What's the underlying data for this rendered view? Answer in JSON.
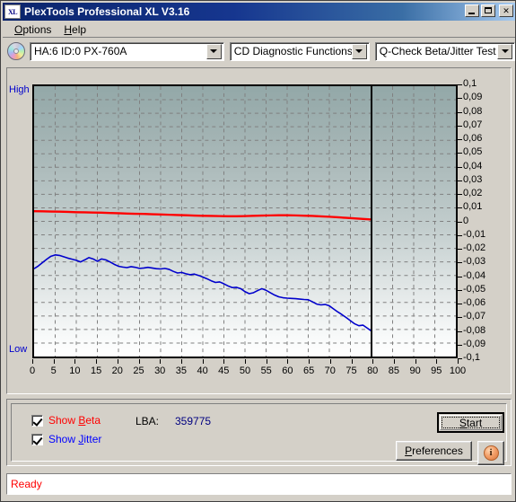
{
  "window": {
    "title": "PlexTools Professional XL V3.16",
    "icon": "XL",
    "controls": {
      "minimize": "minimize-icon",
      "maximize": "maximize-icon",
      "close": "close-icon"
    }
  },
  "menu": {
    "items": [
      {
        "label": "Options",
        "accel": "O"
      },
      {
        "label": "Help",
        "accel": "H"
      }
    ]
  },
  "toolbar": {
    "disc_icon": "cd-disc-icon",
    "drive_select": {
      "value": "HA:6 ID:0  PX-760A",
      "options": [
        "HA:6 ID:0  PX-760A"
      ]
    },
    "function_select": {
      "value": "CD Diagnostic Functions",
      "options": [
        "CD Diagnostic Functions"
      ]
    },
    "test_select": {
      "value": "Q-Check Beta/Jitter Test",
      "options": [
        "Q-Check Beta/Jitter Test"
      ]
    }
  },
  "options_panel": {
    "show_beta": {
      "label": "Show Beta",
      "accel": "B",
      "checked": true,
      "color": "#ff0000"
    },
    "show_jitter": {
      "label": "Show Jitter",
      "accel": "J",
      "checked": true,
      "color": "#0000ff"
    },
    "lba_label": "LBA:",
    "lba_value": "359775",
    "start_button": {
      "label": "Start",
      "accel": "S"
    },
    "preferences_button": {
      "label": "Preferences",
      "accel": "P"
    },
    "info_button": {
      "icon": "info-icon",
      "glyph": "i"
    }
  },
  "statusbar": {
    "text": "Ready"
  },
  "chart_data": {
    "type": "line",
    "title": "Q-Check Beta/Jitter Test",
    "xlabel": "",
    "ylabel": "",
    "xlim": [
      0,
      100
    ],
    "ylim": [
      -0.1,
      0.1
    ],
    "x_ticks": [
      0,
      5,
      10,
      15,
      20,
      25,
      30,
      35,
      40,
      45,
      50,
      55,
      60,
      65,
      70,
      75,
      80,
      85,
      90,
      95,
      100
    ],
    "y_ticks": [
      "0,1",
      "0,09",
      "0,08",
      "0,07",
      "0,06",
      "0,05",
      "0,04",
      "0,03",
      "0,02",
      "0,01",
      "0",
      "-0,01",
      "-0,02",
      "-0,03",
      "-0,04",
      "-0,05",
      "-0,06",
      "-0,07",
      "-0,08",
      "-0,09",
      "-0,1"
    ],
    "y_tick_values": [
      0.1,
      0.09,
      0.08,
      0.07,
      0.06,
      0.05,
      0.04,
      0.03,
      0.02,
      0.01,
      0,
      -0.01,
      -0.02,
      -0.03,
      -0.04,
      -0.05,
      -0.06,
      -0.07,
      -0.08,
      -0.09,
      -0.1
    ],
    "axis_labels": {
      "top_left": "High",
      "bottom_left": "Low"
    },
    "grid": true,
    "grid_style": "dashed",
    "grid_color": "#808080",
    "background_gradient": [
      "#93a8a8",
      "#ffffff"
    ],
    "data_end_marker": {
      "x": 80,
      "color": "#000000"
    },
    "legend": [
      "Beta",
      "Jitter"
    ],
    "series": [
      {
        "name": "Beta",
        "color": "#ff0000",
        "x": [
          0,
          2,
          4,
          6,
          8,
          10,
          12,
          14,
          16,
          18,
          20,
          22,
          24,
          26,
          28,
          30,
          32,
          34,
          36,
          38,
          40,
          42,
          44,
          46,
          48,
          50,
          52,
          54,
          56,
          58,
          60,
          62,
          64,
          66,
          68,
          70,
          72,
          74,
          76,
          78,
          80
        ],
        "values": [
          0.0075,
          0.0074,
          0.0073,
          0.0072,
          0.007,
          0.0068,
          0.0067,
          0.0065,
          0.0064,
          0.0062,
          0.006,
          0.0058,
          0.0056,
          0.0055,
          0.0053,
          0.0051,
          0.0049,
          0.0047,
          0.0045,
          0.0043,
          0.0041,
          0.004,
          0.0039,
          0.0038,
          0.0038,
          0.0039,
          0.0041,
          0.0043,
          0.0044,
          0.0045,
          0.0045,
          0.0044,
          0.0042,
          0.004,
          0.0037,
          0.0034,
          0.003,
          0.0026,
          0.0022,
          0.0018,
          0.0014
        ]
      },
      {
        "name": "Jitter",
        "color": "#0000cc",
        "x": [
          0,
          1,
          2,
          3,
          4,
          5,
          6,
          7,
          8,
          9,
          10,
          11,
          12,
          13,
          14,
          15,
          16,
          17,
          18,
          19,
          20,
          21,
          22,
          23,
          24,
          25,
          26,
          27,
          28,
          29,
          30,
          31,
          32,
          33,
          34,
          35,
          36,
          37,
          38,
          39,
          40,
          41,
          42,
          43,
          44,
          45,
          46,
          47,
          48,
          49,
          50,
          51,
          52,
          53,
          54,
          55,
          56,
          57,
          58,
          59,
          60,
          61,
          62,
          63,
          64,
          65,
          66,
          67,
          68,
          69,
          70,
          71,
          72,
          73,
          74,
          75,
          76,
          77,
          78,
          79,
          80
        ],
        "values": [
          -0.035,
          -0.033,
          -0.0305,
          -0.028,
          -0.0258,
          -0.0248,
          -0.0252,
          -0.0262,
          -0.0272,
          -0.028,
          -0.0288,
          -0.03,
          -0.0285,
          -0.0268,
          -0.0278,
          -0.0295,
          -0.0278,
          -0.0285,
          -0.03,
          -0.0318,
          -0.0332,
          -0.0338,
          -0.0342,
          -0.0335,
          -0.034,
          -0.0348,
          -0.0345,
          -0.034,
          -0.0345,
          -0.035,
          -0.0352,
          -0.0348,
          -0.0355,
          -0.037,
          -0.0382,
          -0.0378,
          -0.0388,
          -0.0395,
          -0.039,
          -0.04,
          -0.0412,
          -0.0425,
          -0.044,
          -0.0452,
          -0.0448,
          -0.0462,
          -0.0478,
          -0.049,
          -0.0488,
          -0.0498,
          -0.052,
          -0.0535,
          -0.0528,
          -0.0512,
          -0.0498,
          -0.051,
          -0.0528,
          -0.0545,
          -0.0558,
          -0.0565,
          -0.0568,
          -0.057,
          -0.0572,
          -0.0575,
          -0.0578,
          -0.058,
          -0.0595,
          -0.0612,
          -0.0618,
          -0.0615,
          -0.0625,
          -0.0648,
          -0.067,
          -0.069,
          -0.0712,
          -0.0735,
          -0.0758,
          -0.0772,
          -0.0768,
          -0.079,
          -0.0812
        ]
      }
    ]
  }
}
